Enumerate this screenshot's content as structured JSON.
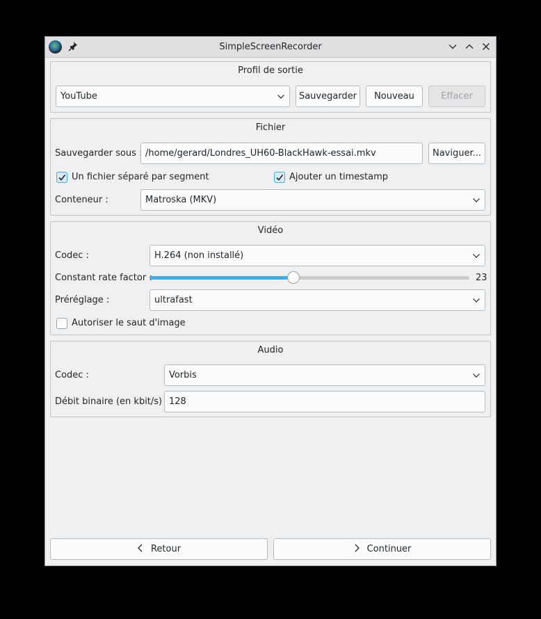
{
  "window": {
    "title": "SimpleScreenRecorder"
  },
  "profile": {
    "title": "Profil de sortie",
    "selected": "YouTube",
    "save_label": "Sauvegarder",
    "new_label": "Nouveau",
    "delete_label": "Effacer"
  },
  "file": {
    "title": "Fichier",
    "save_as_label": "Sauvegarder sous :",
    "path": "/home/gerard/Londres_UH60-BlackHawk-essai.mkv",
    "browse_label": "Naviguer...",
    "separate_file_label": "Un fichier séparé par segment",
    "separate_file_checked": true,
    "timestamp_label": "Ajouter un timestamp",
    "timestamp_checked": true,
    "container_label": "Conteneur :",
    "container": "Matroska (MKV)"
  },
  "video": {
    "title": "Vidéo",
    "codec_label": "Codec :",
    "codec": "H.264 (non installé)",
    "crf_label": "Constant rate factor :",
    "crf_value": "23",
    "crf_fraction": 0.451,
    "preset_label": "Préréglage :",
    "preset": "ultrafast",
    "allow_skip_label": "Autoriser le saut d'image",
    "allow_skip_checked": false
  },
  "audio": {
    "title": "Audio",
    "codec_label": "Codec :",
    "codec": "Vorbis",
    "bitrate_label": "Débit binaire (en kbit/s) :",
    "bitrate": "128"
  },
  "footer": {
    "back_label": "Retour",
    "continue_label": "Continuer"
  }
}
